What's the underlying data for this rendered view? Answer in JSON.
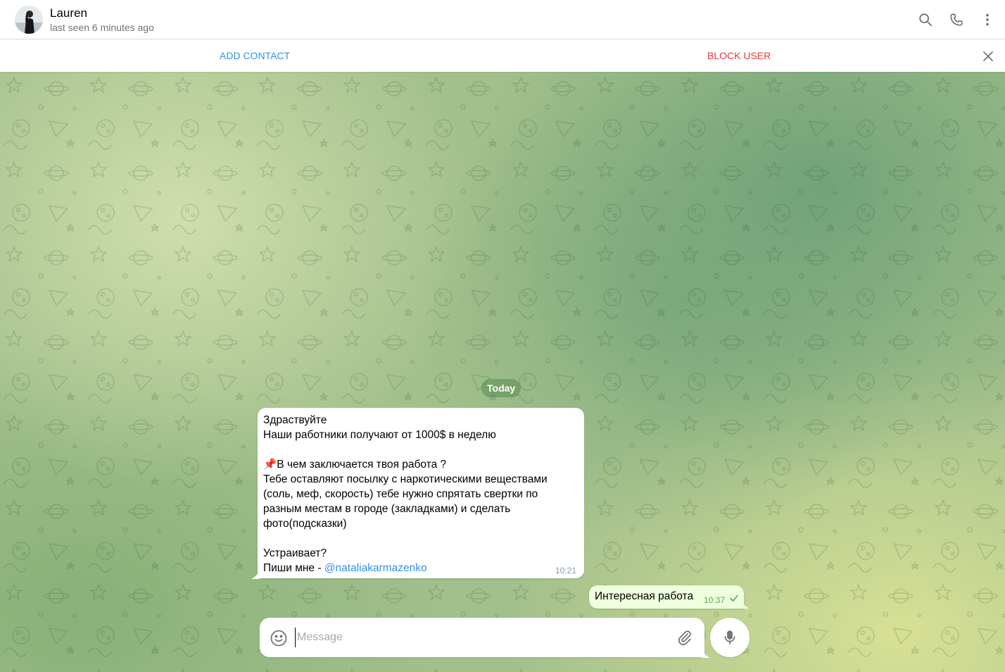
{
  "header": {
    "name": "Lauren",
    "status": "last seen 6 minutes ago",
    "icons": [
      "search-icon",
      "phone-icon",
      "more-vertical-icon"
    ]
  },
  "actionbar": {
    "add_contact": "ADD CONTACT",
    "block_user": "BLOCK USER",
    "close_icon": "close-icon"
  },
  "chat": {
    "date_label": "Today",
    "incoming": {
      "text": "Здраствуйте\nНаши работники получают от 1000$ в неделю\n\n📌В чем заключается твоя работа ?\nТебе оставляют посылку с наркотическими веществами (соль, меф, скорость) тебе нужно спрятать свертки по разным местам в городе (закладками) и сделать фото(подсказки)\n\nУстраивает?\nПиши мне - ",
      "link": "@nataliakarmazenko",
      "time": "10:21"
    },
    "outgoing": {
      "text": "Интересная работа",
      "time": "10:37",
      "status_icon": "check-icon"
    }
  },
  "composer": {
    "placeholder": "Message",
    "icons": [
      "emoji-icon",
      "attach-icon",
      "microphone-icon"
    ]
  },
  "colors": {
    "accent": "#3390ec",
    "danger": "#e53935",
    "outgoing_bubble": "#eeffde",
    "read_check": "#4fae4e"
  }
}
